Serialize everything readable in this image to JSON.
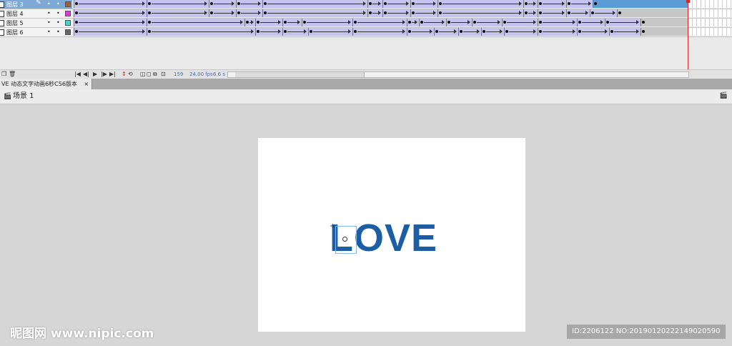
{
  "timeline": {
    "layers": [
      {
        "name": "图层 3",
        "selected": true,
        "color": "#a0622d",
        "edit_icon": "pencil-icon",
        "show": "•",
        "lock": "•"
      },
      {
        "name": "图层 4",
        "selected": false,
        "color": "#d63fd6",
        "show": "•",
        "lock": "•"
      },
      {
        "name": "图层 5",
        "selected": false,
        "color": "#3fd6d6",
        "show": "•",
        "lock": "•"
      },
      {
        "name": "图层 6",
        "selected": false,
        "color": "#666666",
        "show": "•",
        "lock": "•"
      }
    ],
    "current_frame": "159",
    "fps": "24.00 fps",
    "time": "6.6 s",
    "controls": [
      "|◀",
      "◀|",
      "▶",
      "|▶",
      "▶|"
    ]
  },
  "document": {
    "tab_label": "VE 动态文字动画6秒CS6版本",
    "tab_close": "×",
    "scene_label": "场景 1"
  },
  "stage": {
    "text": "LOVE",
    "text_color": "#1b5ea6"
  },
  "watermark": {
    "left": "昵图网 www.nipic.com",
    "right": "ID:2206122 NO:20190120222149020590"
  }
}
